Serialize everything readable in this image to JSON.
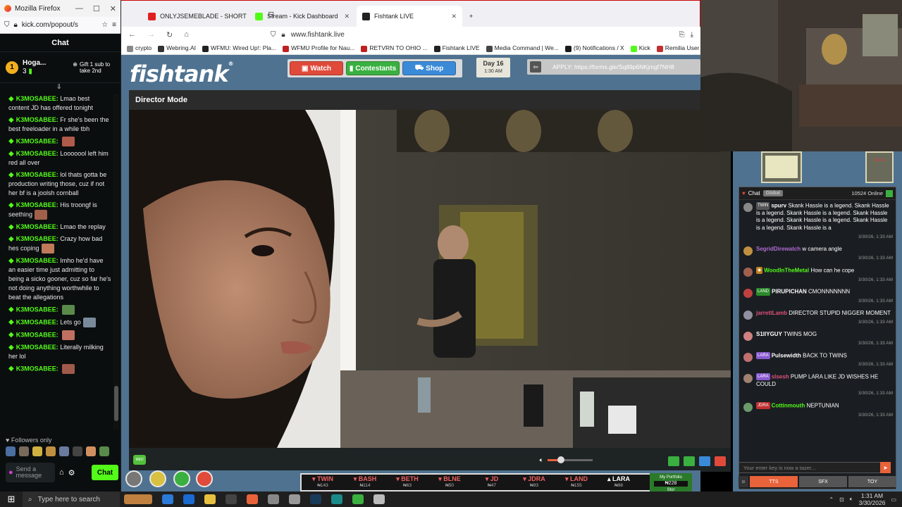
{
  "kick_window": {
    "title": "Mozilla Firefox",
    "url": "kick.com/popout/s",
    "chat_header": "Chat",
    "pinned": {
      "rank": "1",
      "user": "Hoga...",
      "count": "3",
      "gift_text": "Gift 1 sub to take 2nd"
    },
    "messages": [
      {
        "user": "K3MOSABEE:",
        "text": "Lmao best content JD has offered tonight",
        "emote": ""
      },
      {
        "user": "K3MOSABEE:",
        "text": "Fr she's been the best freeloader in a while tbh",
        "emote": ""
      },
      {
        "user": "K3MOSABEE:",
        "text": "",
        "emote": "#b05a4a"
      },
      {
        "user": "K3MOSABEE:",
        "text": "Looooool left him red all over",
        "emote": ""
      },
      {
        "user": "K3MOSABEE:",
        "text": "lol thats gotta be production writing those, cuz if not her bf is a joolsh cornball",
        "emote": ""
      },
      {
        "user": "K3MOSABEE:",
        "text": "His troongf is seething",
        "emote": "#a0604a"
      },
      {
        "user": "K3MOSABEE:",
        "text": "Lmao the replay",
        "emote": ""
      },
      {
        "user": "K3MOSABEE:",
        "text": "Crazy how bad hes coping",
        "emote": "#c07a5a"
      },
      {
        "user": "K3MOSABEE:",
        "text": "Imho he'd have an easier time just admitting to being a sicko gooner, cuz so far he's not doing anything worthwhile to beat the allegations",
        "emote": ""
      },
      {
        "user": "K3MOSABEE:",
        "text": "",
        "emote": "#5a8a4a"
      },
      {
        "user": "K3MOSABEE:",
        "text": "Lets go",
        "emote": "#7a8a9a"
      },
      {
        "user": "K3MOSABEE:",
        "text": "",
        "emote": "#c07060"
      },
      {
        "user": "K3MOSABEE:",
        "text": "Literally milking her lol",
        "emote": ""
      },
      {
        "user": "K3MOSABEE:",
        "text": "",
        "emote": "#a05a4a"
      }
    ],
    "followers_only": "Followers only",
    "input_placeholder": "Send a message",
    "chat_button": "Chat"
  },
  "browser": {
    "tabs": [
      {
        "label": "ONLYJSEMEBLADE - SHORT CA",
        "color": "#e02020",
        "active": false
      },
      {
        "label": "Stream - Kick Dashboard",
        "color": "#53fc18",
        "active": false
      },
      {
        "label": "Fishtank LIVE",
        "color": "#222222",
        "active": true
      }
    ],
    "url": "www.fishtank.live",
    "bookmarks": [
      "crypto",
      "Webring.AI",
      "WFMU: Wired Up!: Pla...",
      "WFMU Profile for Nau...",
      "RETVRN TO OHIO ...",
      "Fishtank LIVE",
      "Media Command | We...",
      "(9) Notifications / X",
      "Kick",
      "Remilia User Profiles"
    ]
  },
  "site": {
    "logo": "fishtank",
    "nav": {
      "watch": "Watch",
      "contestants": "Contestants",
      "shop": "Shop"
    },
    "day": "Day 16",
    "time": "1:30 AM",
    "apply": "APPLY: https://forms.gle/Sq89p6NKjmgf7NH8",
    "director_mode": "Director Mode",
    "quality_badge": "MED",
    "roster": [
      {
        "name": "TWIN",
        "score": "₦143"
      },
      {
        "name": "BASH",
        "score": "₦114"
      },
      {
        "name": "BETH",
        "score": "₦63"
      },
      {
        "name": "BLNE",
        "score": "₦50"
      },
      {
        "name": "JD",
        "score": "₦47"
      },
      {
        "name": "JDRA",
        "score": "₦93"
      },
      {
        "name": "LAND",
        "score": "₦155"
      },
      {
        "name": "LARA",
        "score": "₦98"
      }
    ],
    "portfolio": {
      "label": "My Portfolio",
      "value": "₦228",
      "sub": "Stor"
    },
    "volume": 0.3
  },
  "fishtank_chat": {
    "tab_chat": "Chat",
    "tab_global": "Global",
    "online": "10524 Online",
    "card_label": "Arena",
    "messages": [
      {
        "badge": "TWIN",
        "badge_color": "#555",
        "user": "spurv",
        "user_color": "#ffffff",
        "text": "Skank Hassle is a legend. Skank Hassle is a legend. Skank Hassle is a legend. Skank Hassle is a legend. Skank Hassle is a legend. Skank Hassle is a legend. Skank Hassle is a",
        "ts": "3/30/26, 1:33 AM",
        "av": "#888"
      },
      {
        "badge": "",
        "badge_color": "",
        "user": "SegridDirewatch",
        "user_color": "#b06ad0",
        "text": "w camera angle",
        "ts": "3/30/26, 1:33 AM",
        "av": "#c09040"
      },
      {
        "badge": "",
        "badge_color": "#c08020",
        "user": "WoodInTheMetal",
        "user_color": "#53fc18",
        "text": "How can he cope",
        "ts": "3/30/26, 1:33 AM",
        "av": "#a06050"
      },
      {
        "badge": "LAND",
        "badge_color": "#2a8a2a",
        "user": "PIRUPICHAN",
        "user_color": "#ffffff",
        "text": "CMONNNNNNN",
        "ts": "3/30/26, 1:33 AM",
        "av": "#c04040"
      },
      {
        "badge": "",
        "badge_color": "",
        "user": "jarrettLamb",
        "user_color": "#e0507a",
        "text": "DIRECTOR STUPID NIGGER MOMENT",
        "ts": "3/30/26, 1:33 AM",
        "av": "#9090a0"
      },
      {
        "badge": "",
        "badge_color": "",
        "user": "S1llYGUY",
        "user_color": "#ffffff",
        "text": "TWINS MOG",
        "ts": "3/30/26, 1:33 AM",
        "av": "#d08080"
      },
      {
        "badge": "LARA",
        "badge_color": "#8a5ad0",
        "user": "Pulsewidth",
        "user_color": "#ffffff",
        "text": "BACK TO TWINS",
        "ts": "3/30/26, 1:33 AM",
        "av": "#c07070"
      },
      {
        "badge": "LARA",
        "badge_color": "#8a5ad0",
        "user": "slsesh",
        "user_color": "#e0507a",
        "text": "PUMP LARA LIKE JD WISHES HE COULD",
        "ts": "3/30/26, 1:33 AM",
        "av": "#a08070"
      },
      {
        "badge": "JDRA",
        "badge_color": "#c03030",
        "user": "Cottinmouth",
        "user_color": "#53fc18",
        "text": "NEPTUNIAN",
        "ts": "3/30/26, 1:33 AM",
        "av": "#6a9a6a"
      }
    ],
    "input_placeholder": "Your enter key is now a tazer...",
    "buttons": {
      "tts": "TTS",
      "sfx": "SFX",
      "toy": "TOY"
    }
  },
  "taskbar": {
    "search_placeholder": "Type here to search",
    "time": "1:31 AM",
    "date": "3/30/2026"
  }
}
